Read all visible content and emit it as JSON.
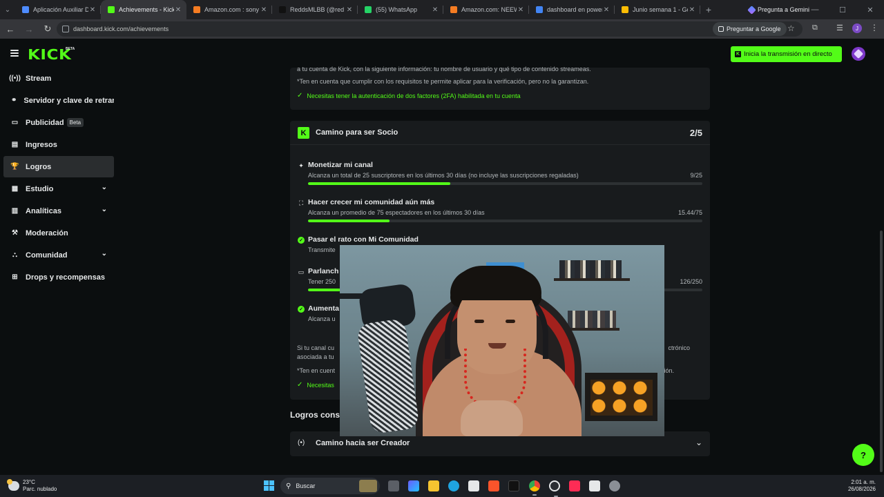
{
  "browser": {
    "tabs": [
      {
        "title": "Aplicación Auxiliar Di",
        "favicon_color": "#4e8cff"
      },
      {
        "title": "Achievements - Kick",
        "favicon_color": "#53fc18",
        "active": true
      },
      {
        "title": "Amazon.com : sony a",
        "favicon_color": "#f57c22"
      },
      {
        "title": "ReddsMLBB (@red",
        "favicon_color": "#111111"
      },
      {
        "title": "(55) WhatsApp",
        "favicon_color": "#25d366"
      },
      {
        "title": "Amazon.com: NEEWI",
        "favicon_color": "#f57c22"
      },
      {
        "title": "dashboard en power",
        "favicon_color": "#4285f4"
      },
      {
        "title": "Junio semana 1 - Go",
        "favicon_color": "#fbbc04"
      }
    ],
    "new_tab_label": "+",
    "gemini_label": "Pregunta a Gemini",
    "url": "dashboard.kick.com/achievements",
    "ask_google_label": "Preguntar a Google",
    "profile_initial": "J"
  },
  "header": {
    "logo": "KICK",
    "logo_tag": "BETA",
    "live_button_label": "Inicia la transmisión en directo"
  },
  "sidebar": {
    "items": [
      {
        "label": "Stream",
        "icon": "broadcast-icon",
        "glyph": "((•))"
      },
      {
        "label": "Servidor y clave de retransmisión",
        "icon": "link-icon",
        "glyph": "⚭"
      },
      {
        "label": "Publicidad",
        "icon": "ad-icon",
        "glyph": "▭",
        "badge": "Beta"
      },
      {
        "label": "Ingresos",
        "icon": "chart-icon",
        "glyph": "▤"
      },
      {
        "label": "Logros",
        "icon": "trophy-icon",
        "glyph": "🏆",
        "active": true
      },
      {
        "label": "Estudio",
        "icon": "studio-icon",
        "glyph": "▦",
        "expandable": true
      },
      {
        "label": "Analíticas",
        "icon": "analytics-icon",
        "glyph": "▥",
        "expandable": true
      },
      {
        "label": "Moderación",
        "icon": "hammer-icon",
        "glyph": "⚒"
      },
      {
        "label": "Comunidad",
        "icon": "community-icon",
        "glyph": "⛬",
        "expandable": true
      },
      {
        "label": "Drops y recompensas",
        "icon": "gift-icon",
        "glyph": "⊞"
      }
    ]
  },
  "verification_card": {
    "line1": "a tu cuenta de Kick, con la siguiente información: tu nombre de usuario y qué tipo de contenido streameas.",
    "line2": "*Ten en cuenta que cumplir con los requisitos te permite aplicar para la verificación, pero no la garantizan.",
    "check": "Necesitas tener la autenticación de dos factores (2FA) habilitada en tu cuenta"
  },
  "partner_card": {
    "title": "Camino para ser Socio",
    "count": "2/5",
    "tasks": [
      {
        "title": "Monetizar mi canal",
        "desc": "Alcanza un total de 25 suscriptores en los últimos 30 días (no incluye las suscripciones regaladas)",
        "value": "9/25",
        "progress": 0.36,
        "icon": "sparkle-icon",
        "glyph": "✦",
        "done": false
      },
      {
        "title": "Hacer crecer mi comunidad aún más",
        "desc": "Alcanza un promedio de 75 espectadores en los últimos 30 días",
        "value": "15.44/75",
        "progress": 0.206,
        "icon": "people-icon",
        "glyph": "⛶",
        "done": false
      },
      {
        "title": "Pasar el rato con Mi Comunidad",
        "desc": "Transmite",
        "value": "",
        "progress": null,
        "icon": "check-icon",
        "glyph": "✓",
        "done": true
      },
      {
        "title": "Parlanch",
        "desc": "Tener 250",
        "value": "126/250",
        "progress": 0.504,
        "icon": "chat-icon",
        "glyph": "▭",
        "done": false
      },
      {
        "title": "Aumenta",
        "desc": "Alcanza u",
        "value": "",
        "progress": null,
        "icon": "check-icon",
        "glyph": "✓",
        "done": true
      }
    ],
    "footer_line1": "Si tu canal cu",
    "footer_line1_right": "ctrónico",
    "footer_line2": "asociada a tu",
    "footer_line3": "*Ten en cuent",
    "footer_line3_right": "ión.",
    "footer_check": "Necesitas"
  },
  "section_title": "Logros cons",
  "creator_card": {
    "title": "Camino hacia ser Creador",
    "icon": "broadcast-icon"
  },
  "taskbar": {
    "temperature": "23°C",
    "weather": "Parc. nublado",
    "search_label": "Buscar",
    "time": "2:01 a. m.",
    "date": "26/08/2026"
  }
}
